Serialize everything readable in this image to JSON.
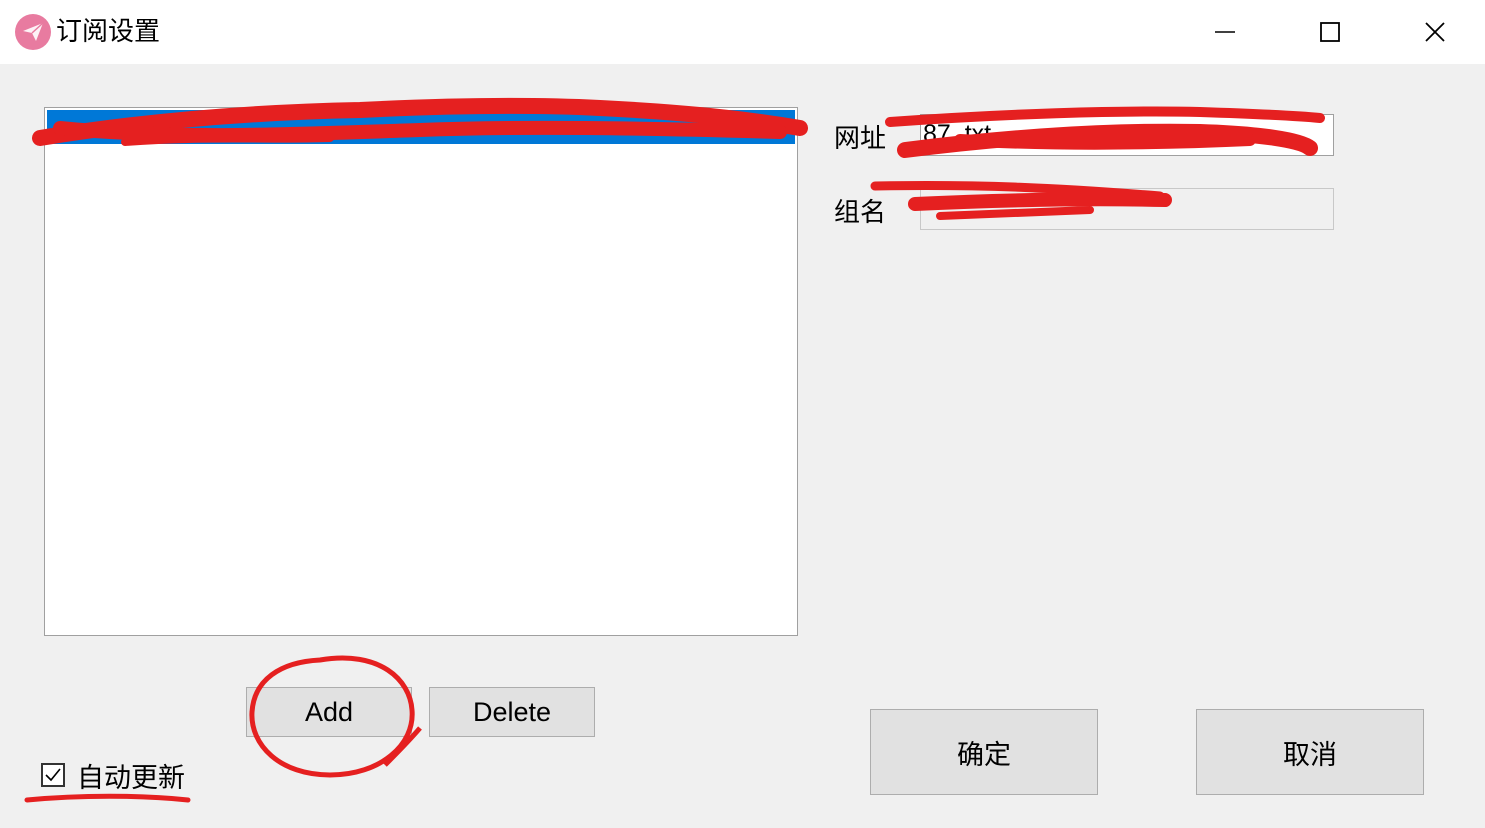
{
  "window": {
    "title": "订阅设置",
    "minimize_icon": "minimize-icon",
    "maximize_icon": "maximize-icon",
    "close_icon": "close-icon"
  },
  "subscription_list": {
    "items": [
      {
        "label": "",
        "selected": true
      }
    ]
  },
  "form": {
    "url_label": "网址",
    "url_value": "87                         .txt",
    "group_label": "组名",
    "group_value": ""
  },
  "buttons": {
    "add": "Add",
    "delete": "Delete",
    "confirm": "确定",
    "cancel": "取消"
  },
  "auto_update": {
    "label": "自动更新",
    "checked": true
  },
  "colors": {
    "selection": "#0078d7",
    "app_icon": "#e87ba0",
    "annotation": "#e52020"
  }
}
